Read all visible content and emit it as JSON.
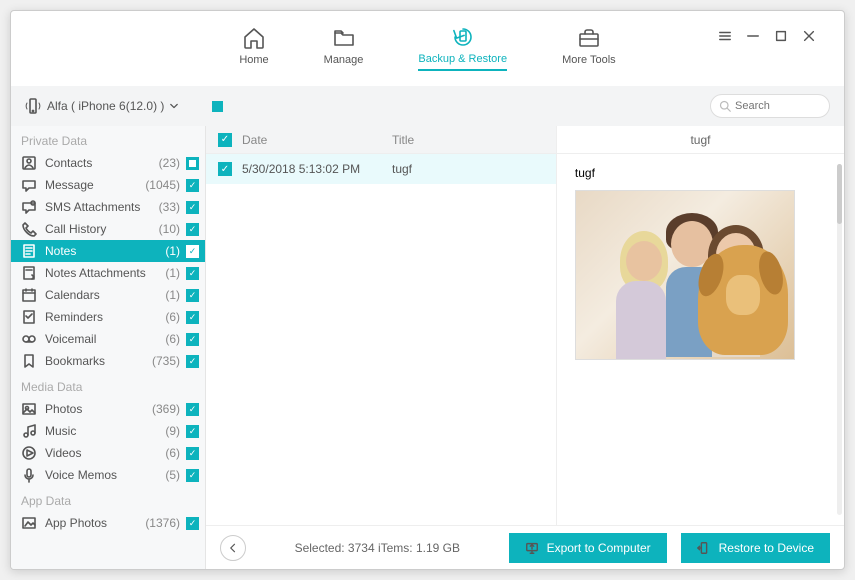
{
  "window_controls": {
    "menu": "menu-icon",
    "min": "minimize-icon",
    "max": "maximize-icon",
    "close": "close-icon"
  },
  "topnav": {
    "home": "Home",
    "manage": "Manage",
    "backup": "Backup & Restore",
    "tools": "More Tools",
    "active": "backup"
  },
  "device": {
    "name": "Alfa ( iPhone 6(12.0) )"
  },
  "search": {
    "placeholder": "Search"
  },
  "sidebar": {
    "groups": [
      {
        "title": "Private Data",
        "items": [
          {
            "icon": "contact-icon",
            "label": "Contacts",
            "count": "(23)",
            "chk": "stop"
          },
          {
            "icon": "message-icon",
            "label": "Message",
            "count": "(1045)",
            "chk": "checked"
          },
          {
            "icon": "sms-attach-icon",
            "label": "SMS Attachments",
            "count": "(33)",
            "chk": "checked"
          },
          {
            "icon": "call-icon",
            "label": "Call History",
            "count": "(10)",
            "chk": "checked"
          },
          {
            "icon": "notes-icon",
            "label": "Notes",
            "count": "(1)",
            "chk": "checked",
            "active": true
          },
          {
            "icon": "notes-attach-icon",
            "label": "Notes Attachments",
            "count": "(1)",
            "chk": "checked"
          },
          {
            "icon": "calendar-icon",
            "label": "Calendars",
            "count": "(1)",
            "chk": "checked"
          },
          {
            "icon": "reminder-icon",
            "label": "Reminders",
            "count": "(6)",
            "chk": "checked"
          },
          {
            "icon": "voicemail-icon",
            "label": "Voicemail",
            "count": "(6)",
            "chk": "checked"
          },
          {
            "icon": "bookmark-icon",
            "label": "Bookmarks",
            "count": "(735)",
            "chk": "checked"
          }
        ]
      },
      {
        "title": "Media Data",
        "items": [
          {
            "icon": "photo-icon",
            "label": "Photos",
            "count": "(369)",
            "chk": "checked"
          },
          {
            "icon": "music-icon",
            "label": "Music",
            "count": "(9)",
            "chk": "checked"
          },
          {
            "icon": "video-icon",
            "label": "Videos",
            "count": "(6)",
            "chk": "checked"
          },
          {
            "icon": "mic-icon",
            "label": "Voice Memos",
            "count": "(5)",
            "chk": "checked"
          }
        ]
      },
      {
        "title": "App Data",
        "items": [
          {
            "icon": "appphoto-icon",
            "label": "App Photos",
            "count": "(1376)",
            "chk": "checked"
          }
        ]
      }
    ]
  },
  "list": {
    "columns": {
      "date": "Date",
      "title": "Title"
    },
    "rows": [
      {
        "date": "5/30/2018 5:13:02 PM",
        "title": "tugf"
      }
    ]
  },
  "preview": {
    "title": "tugf",
    "text": "tugf"
  },
  "footer": {
    "status": "Selected: 3734 iTems: 1.19 GB",
    "export": "Export to Computer",
    "restore": "Restore to Device"
  }
}
